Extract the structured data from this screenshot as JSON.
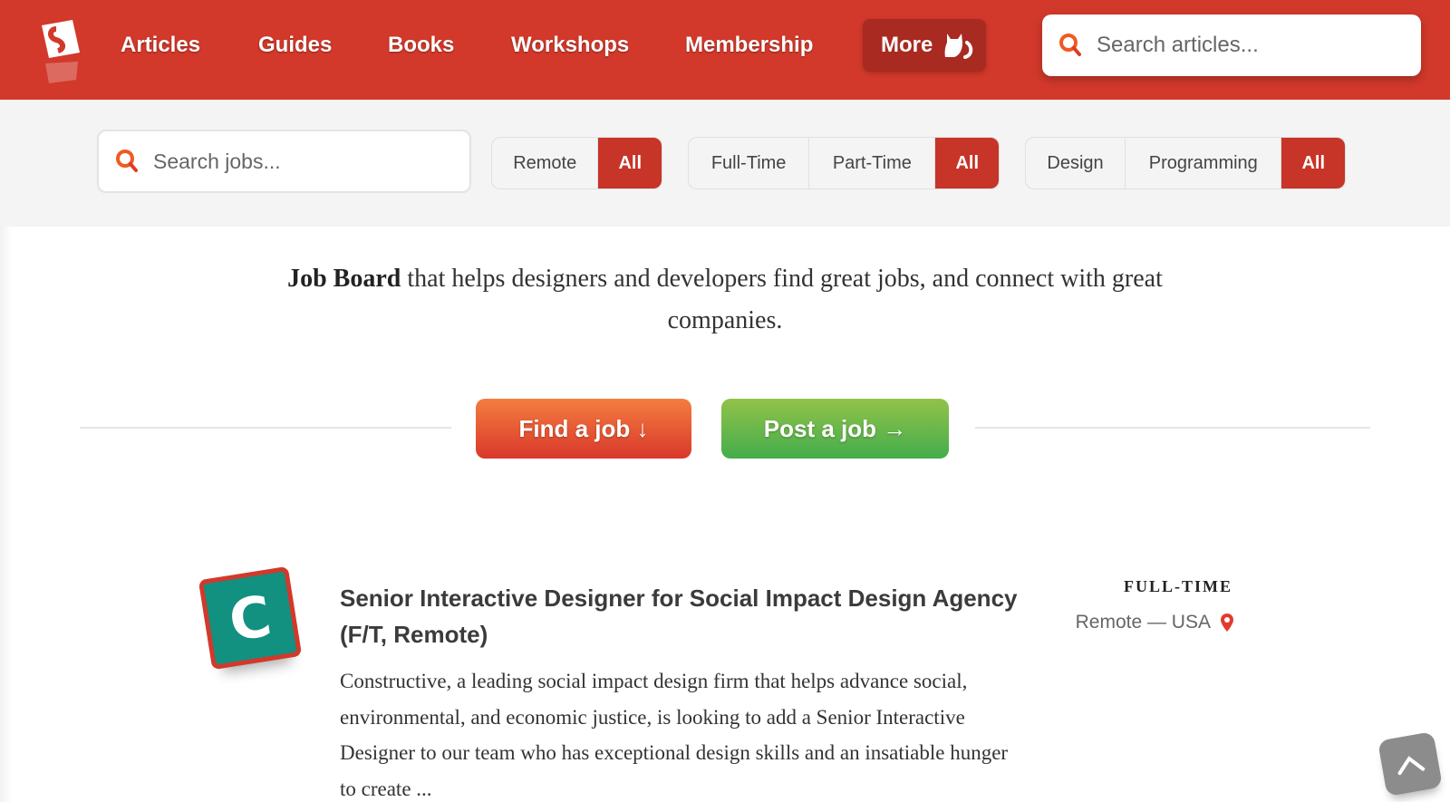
{
  "nav": {
    "logo_alt": "Smashing Magazine logo",
    "links": [
      "Articles",
      "Guides",
      "Books",
      "Workshops",
      "Membership"
    ],
    "more_label": "More",
    "search_placeholder": "Search articles..."
  },
  "filters": {
    "search_placeholder": "Search jobs...",
    "location": {
      "options": [
        "Remote",
        "All"
      ],
      "selected": "All"
    },
    "type": {
      "options": [
        "Full-Time",
        "Part-Time",
        "All"
      ],
      "selected": "All"
    },
    "category": {
      "options": [
        "Design",
        "Programming",
        "All"
      ],
      "selected": "All"
    }
  },
  "intro": {
    "bold": "Job Board",
    "text": " that helps designers and developers find great jobs, and connect with great companies."
  },
  "cta": {
    "find_label": "Find a job ↓",
    "post_label": "Post a job →"
  },
  "jobs": [
    {
      "logo_letter": "C",
      "title": "Senior Interactive Designer for Social Impact Design Agency (F/T, Remote)",
      "description": "Constructive, a leading social impact design firm that helps advance social, environmental, and economic justice, is looking to add a Senior Interactive Designer to our team who has exceptional design skills and an insatiable hunger to create ...",
      "type": "FULL-TIME",
      "location": "Remote — USA"
    }
  ],
  "colors": {
    "brand_red": "#d2392b",
    "active_segment": "#c73428",
    "find_button": "#e9582f",
    "post_button": "#6ab84b",
    "logo_teal": "#129080"
  }
}
